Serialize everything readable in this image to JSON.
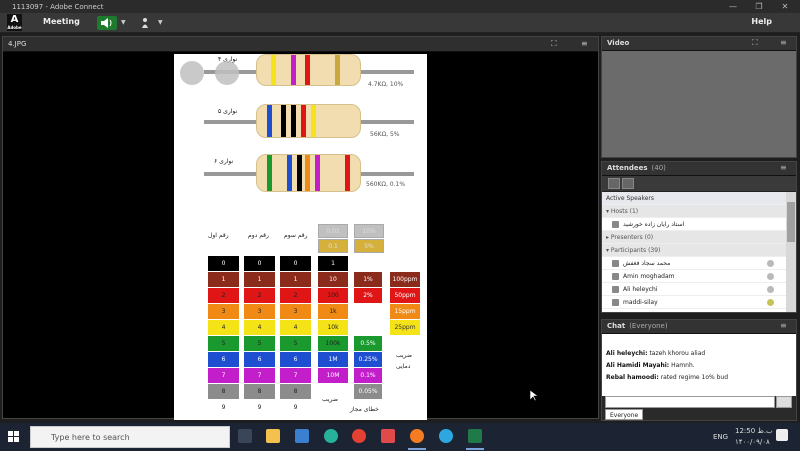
{
  "window": {
    "title": "1113097 - Adobe Connect"
  },
  "menu": {
    "logo": "A",
    "logo_sub": "Adobe",
    "meeting_label": "Meeting",
    "help_label": "Help"
  },
  "share_pod": {
    "title": "4.JPG"
  },
  "slide": {
    "rows": [
      {
        "label": "۴ نواری",
        "value": "4.7KΩ, 10%"
      },
      {
        "label": "۵ نواری",
        "value": "56KΩ, 5%"
      },
      {
        "label": "۶ نواری",
        "value": "560KΩ, 0.1%"
      }
    ],
    "headers": [
      "رقم اول",
      "رقم دوم",
      "رقم سوم"
    ],
    "digits": [
      "0",
      "1",
      "2",
      "3",
      "4",
      "5",
      "6",
      "7",
      "8",
      "9"
    ],
    "multipliers": [
      "1",
      "10",
      "100",
      "1k",
      "10k",
      "100k",
      "1M",
      "10M"
    ],
    "tolerance_top": [
      "0.01",
      "0.1"
    ],
    "tolerance_top2": [
      "10%",
      "5%"
    ],
    "tolerance_mid": [
      "1%",
      "2%"
    ],
    "tolerance_low": [
      "0.5%",
      "0.25%",
      "0.1%",
      "0.05%"
    ],
    "tempco": [
      "100ppm",
      "50ppm",
      "15ppm",
      "25ppm"
    ],
    "footer_multiplier": "ضریب",
    "footer_tolerance": "خطای مجاز",
    "footer_temp": "ضریب دمایی",
    "colors": [
      "#000000",
      "#8b2b1c",
      "#e01515",
      "#f08a14",
      "#f4e316",
      "#1a9a2e",
      "#1f4fd1",
      "#c21ec9",
      "#8c8c8c",
      "#ffffff"
    ]
  },
  "video_pod": {
    "title": "Video"
  },
  "attendees_pod": {
    "title": "Attendees",
    "count": "(40)",
    "active_speakers": "Active Speakers",
    "hosts_label": "Hosts (1)",
    "host_name": "استاد رایان زاده خورشید",
    "presenters_label": "Presenters (0)",
    "participants_label": "Participants (39)",
    "participants": [
      "محمد سجاد فغفش",
      "Amin moghadam",
      "Ali heleychi",
      "maddi-silay"
    ]
  },
  "chat_pod": {
    "title": "Chat",
    "scope": "(Everyone)",
    "messages": [
      {
        "name": "Ali heleychi:",
        "text": "tazeh khorou aliad"
      },
      {
        "name": "Ali Hamidi Mayahi:",
        "text": "Hamnh."
      },
      {
        "name": "Rebal hamoodi:",
        "text": "rated regime 1o% bud"
      }
    ],
    "tab": "Everyone"
  },
  "taskbar": {
    "search_placeholder": "Type here to search",
    "lang": "ENG",
    "time": "12:50 ب.ظ",
    "date": "۱۴۰۰/۰۹/۰۸"
  }
}
